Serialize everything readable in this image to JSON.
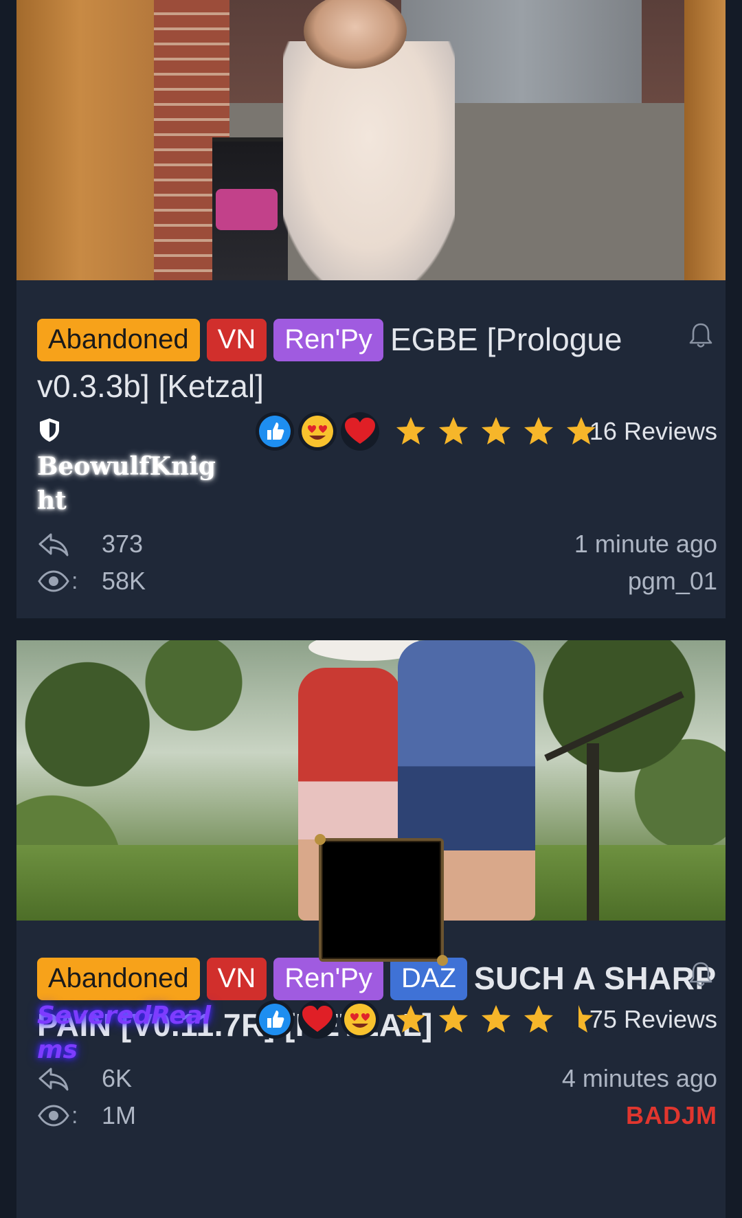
{
  "posts": [
    {
      "tags": [
        "Abandoned",
        "VN",
        "Ren'Py"
      ],
      "title": "EGBE [Prologue v0.3.3b] [Ketzal]",
      "author": "BeowulfKnight",
      "reactions": [
        "thumbs-up",
        "heart-eyes",
        "red-heart"
      ],
      "rating": 5,
      "reviews": "16 Reviews",
      "replies": "373",
      "views": "58K",
      "time": "1 minute ago",
      "last_poster": "pgm_01"
    },
    {
      "tags": [
        "Abandoned",
        "VN",
        "Ren'Py",
        "DAZ"
      ],
      "title": "SUCH A SHARP PAIN [V0.11.7R] [KETZAL]",
      "author": "SeveredRealms",
      "reactions": [
        "thumbs-up",
        "red-heart",
        "heart-eyes"
      ],
      "rating": 4.5,
      "reviews": "75 Reviews",
      "replies": "6K",
      "views": "1M",
      "time": "4 minutes ago",
      "last_poster": "BADJM"
    }
  ],
  "colors": {
    "background": "#141b27",
    "card": "#1f2838",
    "abandoned": "#f7a21a",
    "vn": "#d12f2c",
    "renpy": "#a05be0",
    "daz": "#3f72d6",
    "star": "#f6b62a"
  },
  "icons": {
    "bell": "bell-icon",
    "reply": "reply-icon",
    "views": "eye-icon",
    "author_badge": "shield-icon"
  },
  "stat_separator": ":"
}
